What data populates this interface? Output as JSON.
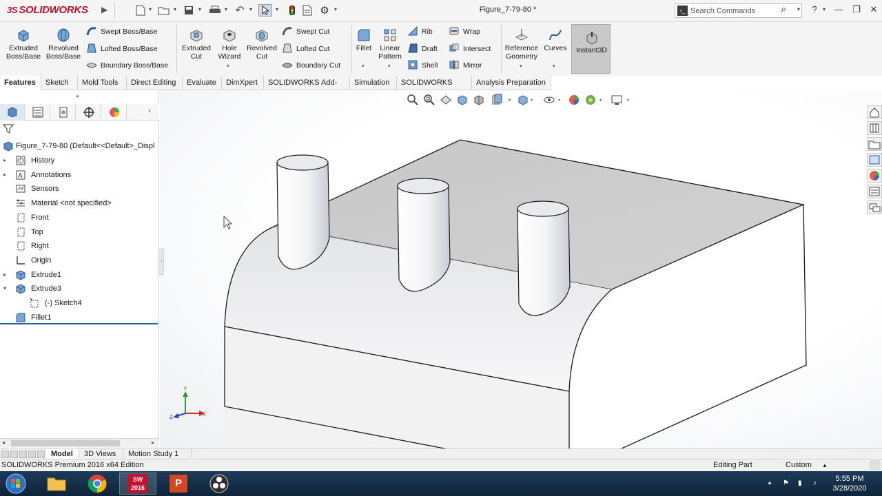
{
  "app": {
    "logo_ds": "3S",
    "logo_text": "SOLIDWORKS",
    "document_title": "Figure_7-79-80 *",
    "search_placeholder": "Search Commands"
  },
  "ribbon": {
    "extruded_boss": "Extruded Boss/Base",
    "revolved_boss": "Revolved Boss/Base",
    "swept_boss": "Swept Boss/Base",
    "lofted_boss": "Lofted Boss/Base",
    "boundary_boss": "Boundary Boss/Base",
    "extruded_cut": "Extruded Cut",
    "hole_wizard": "Hole Wizard",
    "revolved_cut": "Revolved Cut",
    "swept_cut": "Swept Cut",
    "lofted_cut": "Lofted Cut",
    "boundary_cut": "Boundary Cut",
    "fillet": "Fillet",
    "linear_pattern": "Linear Pattern",
    "rib": "Rib",
    "draft": "Draft",
    "shell": "Shell",
    "wrap": "Wrap",
    "intersect": "Intersect",
    "mirror": "Mirror",
    "reference_geometry": "Reference Geometry",
    "curves": "Curves",
    "instant3d": "Instant3D"
  },
  "tabs": [
    "Features",
    "Sketch",
    "Mold Tools",
    "Direct Editing",
    "Evaluate",
    "DimXpert",
    "SOLIDWORKS Add-Ins",
    "Simulation",
    "SOLIDWORKS MBD",
    "Analysis Preparation"
  ],
  "feature_tree": {
    "root": "Figure_7-79-80  (Default<<Default>_Displ",
    "items": [
      {
        "label": "History",
        "icon": "history-folder-icon",
        "expander": "▸"
      },
      {
        "label": "Annotations",
        "icon": "annotations-icon",
        "expander": "▸"
      },
      {
        "label": "Sensors",
        "icon": "sensors-icon",
        "expander": ""
      },
      {
        "label": "Material <not specified>",
        "icon": "material-icon",
        "expander": ""
      },
      {
        "label": "Front",
        "icon": "plane-icon",
        "expander": ""
      },
      {
        "label": "Top",
        "icon": "plane-icon",
        "expander": ""
      },
      {
        "label": "Right",
        "icon": "plane-icon",
        "expander": ""
      },
      {
        "label": "Origin",
        "icon": "origin-icon",
        "expander": ""
      },
      {
        "label": "Extrude1",
        "icon": "extrude-icon",
        "expander": "▸"
      },
      {
        "label": "Extrude3",
        "icon": "extrude-icon",
        "expander": "▾"
      },
      {
        "label": "(-) Sketch4",
        "icon": "sketch-icon",
        "expander": ""
      },
      {
        "label": "Fillet1",
        "icon": "fillet-icon",
        "expander": ""
      }
    ]
  },
  "model_tabs": [
    "Model",
    "3D Views",
    "Motion Study 1"
  ],
  "status": {
    "edition": "SOLIDWORKS Premium 2016 x64 Edition",
    "mode": "Editing Part",
    "units": "Custom"
  },
  "taskbar": {
    "time": "5:55 PM",
    "date": "3/28/2020",
    "sw_label": "2016"
  },
  "triad": {
    "x": "X",
    "y": "Y",
    "z": "Z"
  },
  "colors": {
    "accent_red": "#c8102e",
    "taskbar": "#1c3b5a",
    "rollback_bar": "#2b5fb0"
  }
}
